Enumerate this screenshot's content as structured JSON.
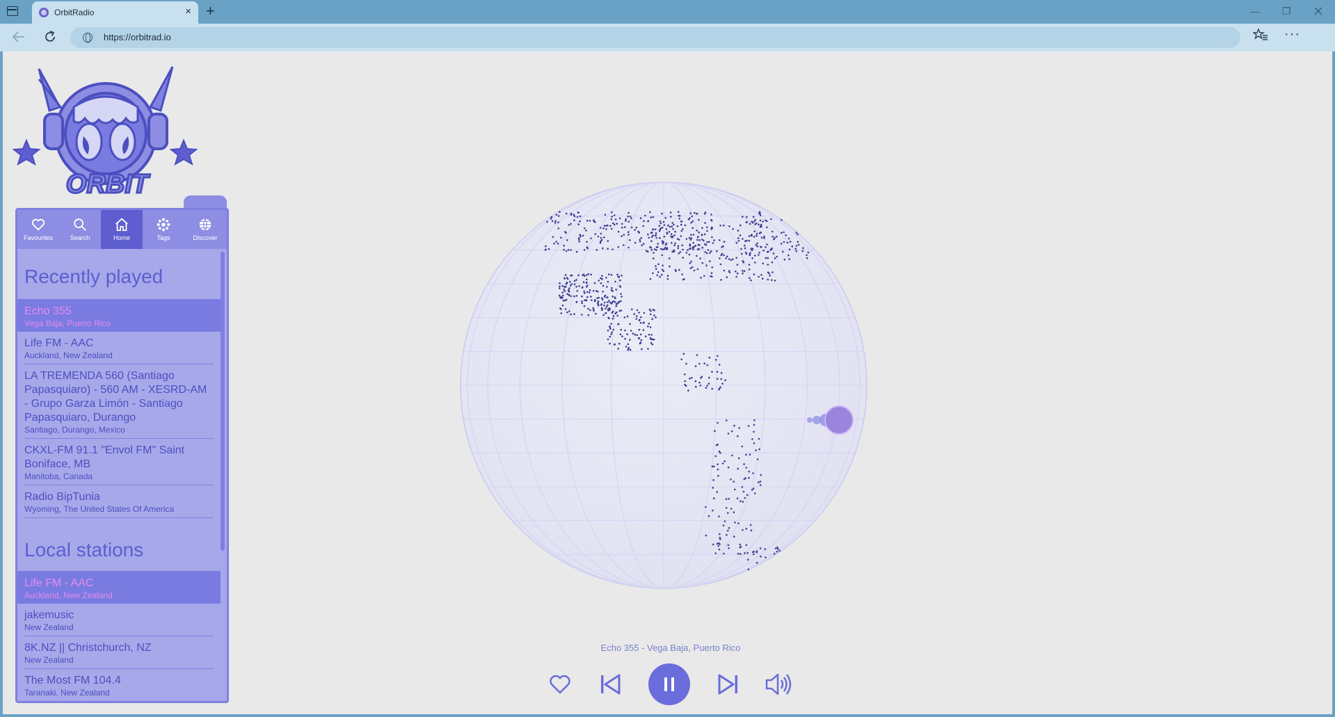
{
  "browser": {
    "tab_title": "OrbitRadio",
    "tab_close": "×",
    "new_tab": "+",
    "url": "https://orbitrad.io",
    "minimize": "—",
    "restore": "❐",
    "more": "···"
  },
  "app": {
    "logo_text": "ORBIT",
    "nav": [
      {
        "label": "Favourites",
        "icon": "heart-icon"
      },
      {
        "label": "Search",
        "icon": "search-icon"
      },
      {
        "label": "Home",
        "icon": "home-icon",
        "active": true
      },
      {
        "label": "Tags",
        "icon": "tags-icon"
      },
      {
        "label": "Discover",
        "icon": "globe-icon"
      }
    ],
    "recently_played": {
      "title": "Recently played",
      "items": [
        {
          "name": "Echo 355",
          "location": "Vega Baja, Puerto Rico",
          "active": true
        },
        {
          "name": "Life FM - AAC",
          "location": "Auckland, New Zealand"
        },
        {
          "name": "LA TREMENDA 560 (Santiago Papasquiaro) - 560 AM - XESRD-AM - Grupo Garza Limón - Santiago Papasquiaro, Durango",
          "location": "Santiago, Durango, Mexico"
        },
        {
          "name": "CKXL-FM 91.1 \"Envol FM\" Saint Boniface, MB",
          "location": "Manitoba, Canada"
        },
        {
          "name": "Radio BipTunia",
          "location": "Wyoming, The United States Of America"
        }
      ]
    },
    "local_stations": {
      "title": "Local stations",
      "items": [
        {
          "name": "Life FM - AAC",
          "location": "Auckland, New Zealand",
          "active": true
        },
        {
          "name": "jakemusic",
          "location": "New Zealand"
        },
        {
          "name": "8K.NZ || Christchurch, NZ",
          "location": "New Zealand"
        },
        {
          "name": "The Most FM 104.4",
          "location": "Taranaki, New Zealand"
        }
      ]
    },
    "player": {
      "now_playing": "Echo 355 - Vega Baja, Puerto Rico",
      "state": "playing"
    },
    "colors": {
      "accent": "#6a6ddb",
      "panel": "#a7a8ea",
      "highlight_text": "#e58bf0",
      "dots": "#3b3f8f"
    }
  }
}
